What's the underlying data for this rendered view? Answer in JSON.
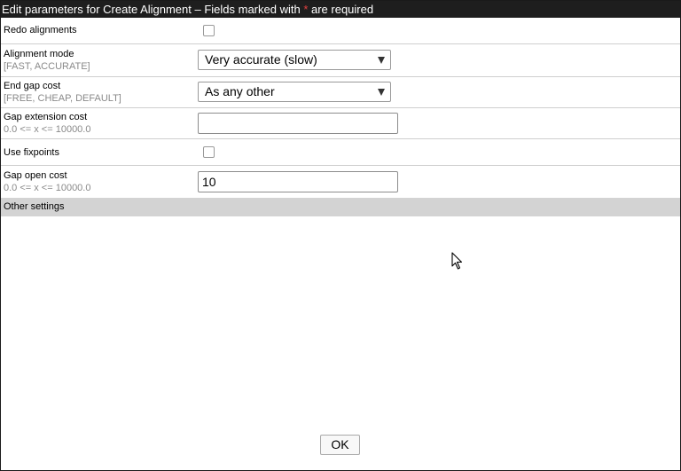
{
  "dialog": {
    "title_prefix": "Edit parameters for Create Alignment – Fields marked with ",
    "required_marker": "*",
    "title_suffix": " are required"
  },
  "fields": {
    "redo_alignments": {
      "label": "Redo alignments",
      "checked": false
    },
    "alignment_mode": {
      "label": "Alignment mode",
      "hint": "[FAST, ACCURATE]",
      "selected": "Very accurate (slow)"
    },
    "end_gap_cost": {
      "label": "End gap cost",
      "hint": "[FREE, CHEAP, DEFAULT]",
      "selected": "As any other"
    },
    "gap_extension_cost": {
      "label": "Gap extension cost",
      "hint": "0.0 <= x <= 10000.0",
      "value": ""
    },
    "use_fixpoints": {
      "label": "Use fixpoints",
      "checked": false
    },
    "gap_open_cost": {
      "label": "Gap open cost",
      "hint": "0.0 <= x <= 10000.0",
      "value": "10"
    }
  },
  "other_settings": {
    "label": "Other settings"
  },
  "buttons": {
    "ok": "OK"
  },
  "icons": {
    "select_arrow": "chevron-down-icon",
    "cursor": "mouse-pointer-icon"
  },
  "colors": {
    "titlebar": "#1e1e1e",
    "required": "#e04040",
    "section": "#d3d3d3",
    "hint": "#8a8a8a"
  }
}
